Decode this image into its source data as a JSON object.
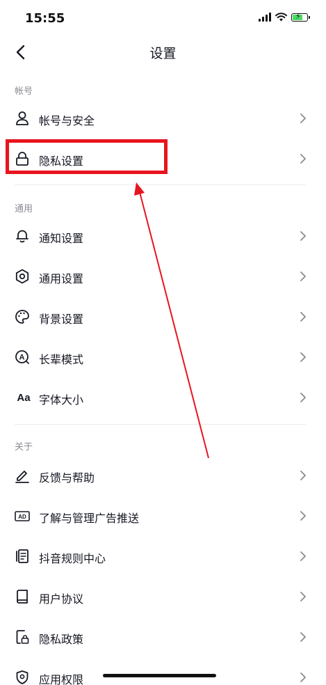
{
  "status_bar": {
    "time": "15:55"
  },
  "nav": {
    "title": "设置"
  },
  "sections": {
    "account": "帐号",
    "general": "通用",
    "about": "关于"
  },
  "items": {
    "account_security": "帐号与安全",
    "privacy_settings": "隐私设置",
    "notification_settings": "通知设置",
    "general_settings": "通用设置",
    "background_settings": "背景设置",
    "elder_mode": "长辈模式",
    "font_size": "字体大小",
    "feedback_help": "反馈与帮助",
    "ad_management": "了解与管理广告推送",
    "community_rules": "抖音规则中心",
    "user_agreement": "用户协议",
    "privacy_policy": "隐私政策",
    "app_permissions": "应用权限"
  },
  "icons": {
    "font_size_glyph": "Aa",
    "ad_glyph": "AD",
    "elder_glyph": "A"
  },
  "colors": {
    "annotation_red": "#e8141f",
    "battery_green": "#4cd964",
    "text_primary": "#161823",
    "text_secondary": "#8a8b91"
  }
}
